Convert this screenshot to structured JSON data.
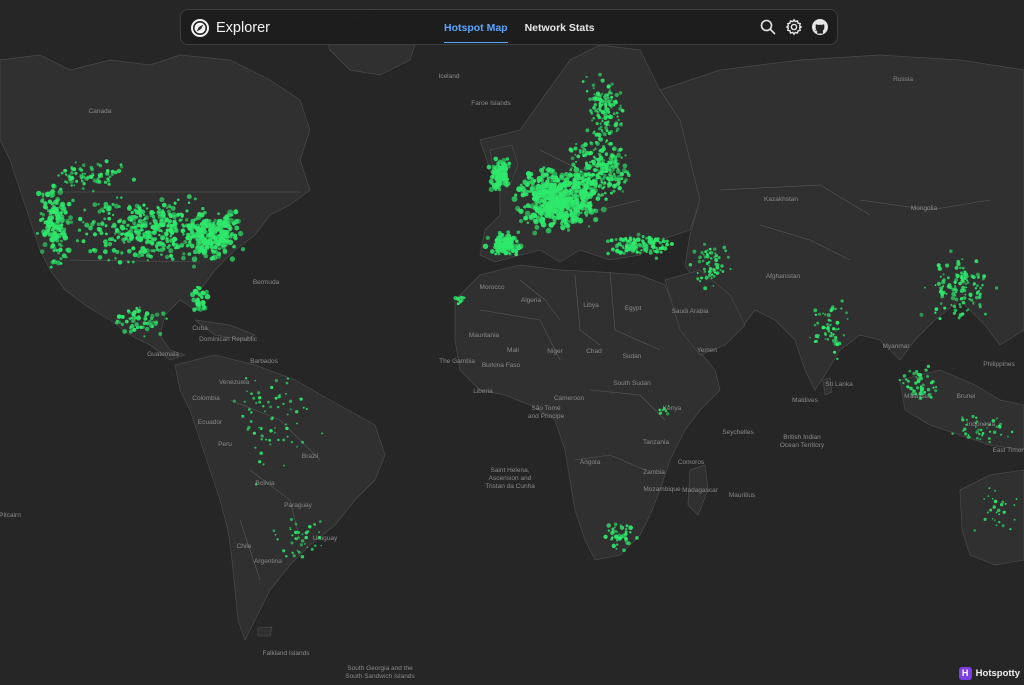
{
  "header": {
    "app_name": "Explorer",
    "tabs": [
      {
        "label": "Hotspot Map",
        "active": true
      },
      {
        "label": "Network Stats",
        "active": false
      }
    ],
    "icons": [
      "search-icon",
      "gear-icon",
      "github-icon"
    ]
  },
  "badge": {
    "label": "Hotspotty",
    "logo_letter": "H"
  },
  "colors": {
    "background": "#262626",
    "land": "#303030",
    "hotspot": "#2ee86b",
    "active_tab": "#5aa6ff",
    "badge": "#7b3fe4"
  },
  "map_labels": [
    "Canada",
    "Iceland",
    "Faroe Islands",
    "Russia",
    "Kazakhstan",
    "Mongolia",
    "Bermuda",
    "Morocco",
    "Algeria",
    "Libya",
    "Egypt",
    "Saudi Arabia",
    "Afghanistan",
    "Mauritania",
    "Mali",
    "Niger",
    "Chad",
    "Sudan",
    "Yemen",
    "The Gambia",
    "Burkina Faso",
    "Liberia",
    "Cameroon",
    "South Sudan",
    "Kenya",
    "Tanzania",
    "Angola",
    "Zambia",
    "Mozambique",
    "Madagascar",
    "Mauritius",
    "Comoros",
    "Seychelles",
    "Maldives",
    "Sri Lanka",
    "British Indian Ocean Territory",
    "Sao Tome and Principe",
    "Saint Helena, Ascension and Tristan da Cunha",
    "Dominican Republic",
    "Barbados",
    "Venezuela",
    "Colombia",
    "Ecuador",
    "Peru",
    "Brazil",
    "Bolivia",
    "Paraguay",
    "Chile",
    "Argentina",
    "Uruguay",
    "Pitcairn",
    "Falkland Islands",
    "South Georgia and South Sandwich Islands",
    "Myanmar",
    "Philippines",
    "Malaysia",
    "Brunei",
    "Indonesia",
    "East Timor",
    "Cuba",
    "Guatemala"
  ]
}
